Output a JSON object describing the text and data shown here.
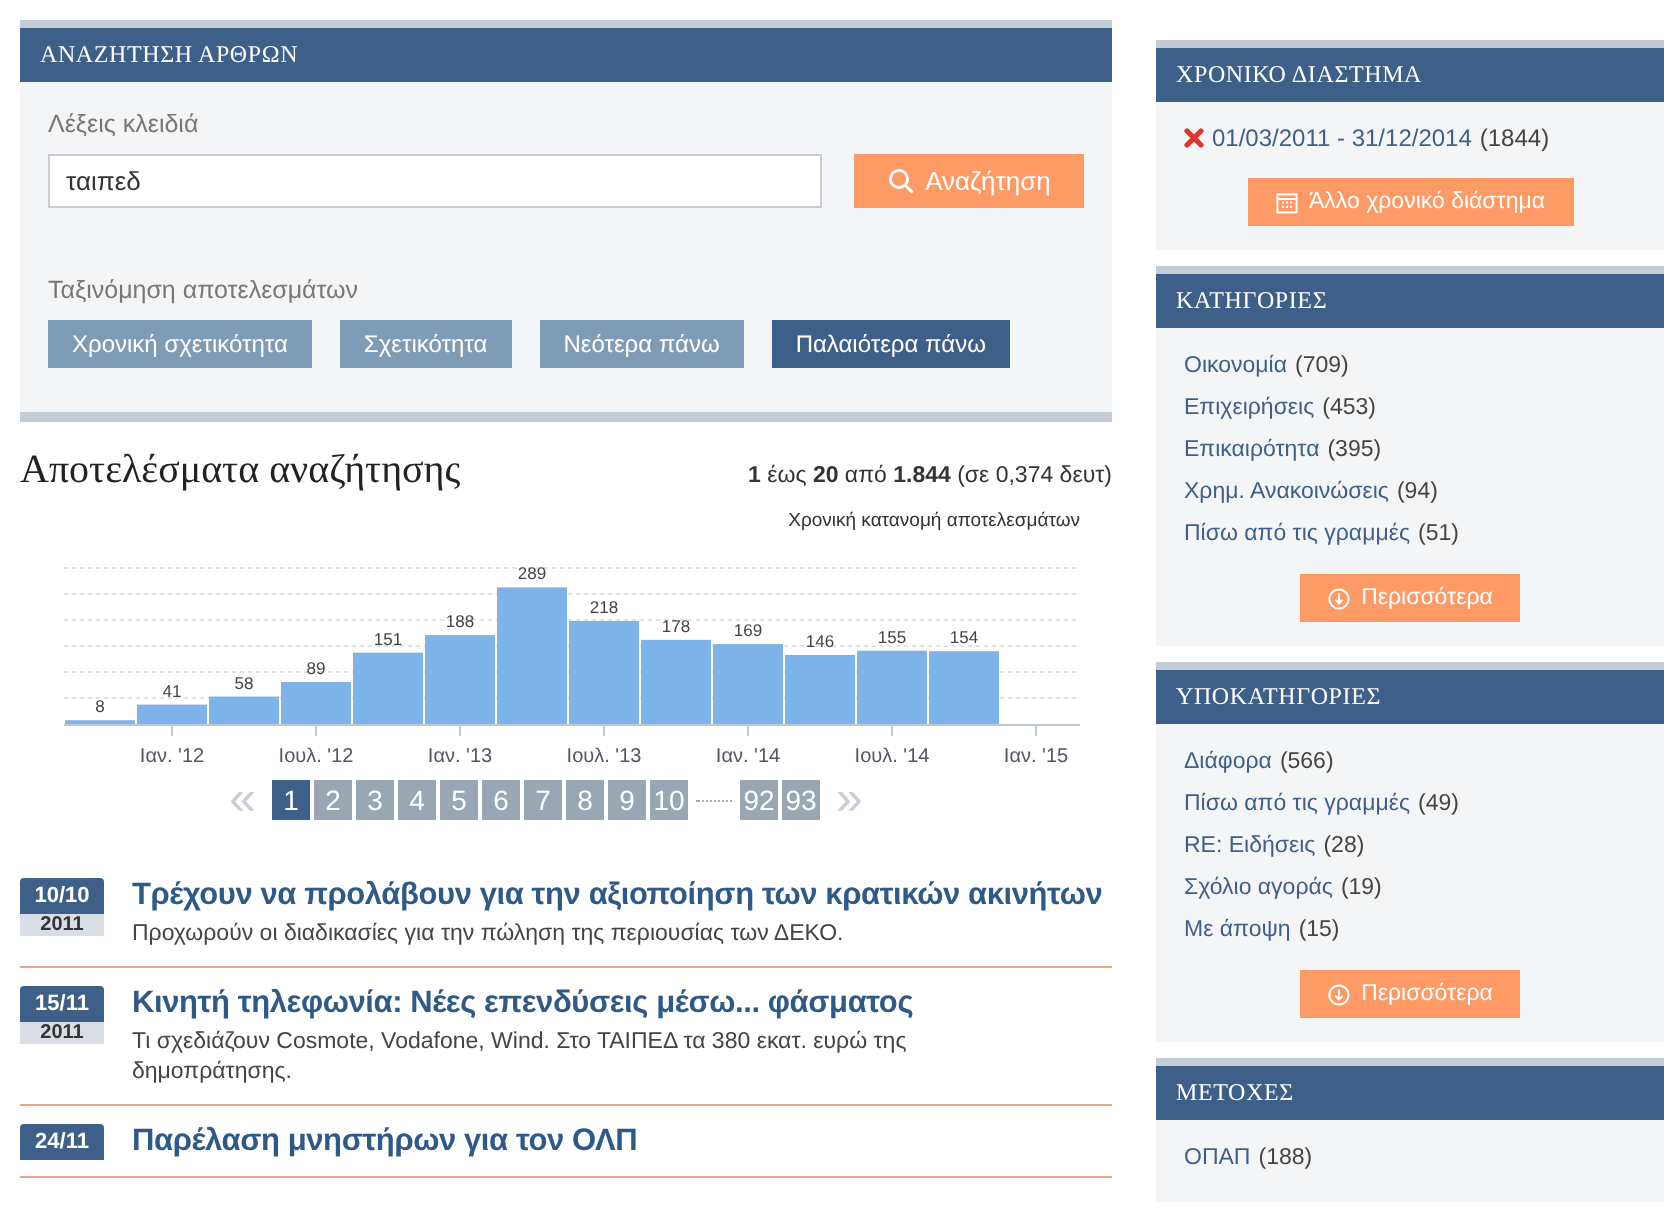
{
  "search_panel": {
    "title": "ΑΝΑΖΗΤΗΣΗ ΑΡΘΡΩΝ",
    "keywords_label": "Λέξεις κλειδιά",
    "keywords_value": "ταιπεδ",
    "search_button": "Αναζήτηση",
    "sort_label": "Ταξινόμηση αποτελεσμάτων",
    "sort_options": [
      {
        "label": "Χρονική σχετικότητα",
        "selected": false
      },
      {
        "label": "Σχετικότητα",
        "selected": false
      },
      {
        "label": "Νεότερα πάνω",
        "selected": false
      },
      {
        "label": "Παλαιότερα πάνω",
        "selected": true
      }
    ]
  },
  "results": {
    "title": "Αποτελέσματα αναζήτησης",
    "summary": "**1** έως **20** από **1.844** (σε 0,374 δευτ)",
    "chart": {
      "caption": "Χρονική κατανομή αποτελεσμάτων",
      "chart_data": {
        "type": "bar",
        "categories": [
          null,
          "Ιαν. '12",
          null,
          "Ιουλ. '12",
          null,
          "Ιαν. '13",
          null,
          "Ιουλ. '13",
          null,
          "Ιαν. '14",
          null,
          "Ιουλ. '14",
          null,
          "Ιαν. '15"
        ],
        "values": [
          8,
          41,
          58,
          89,
          151,
          188,
          289,
          218,
          178,
          169,
          146,
          155,
          154,
          null
        ],
        "ylim": [
          0,
          330
        ],
        "data_labels": true
      }
    },
    "pagination": [
      {
        "kind": "arrow",
        "label": "«",
        "selected": false
      },
      {
        "kind": "page",
        "label": "1",
        "selected": true
      },
      {
        "kind": "page",
        "label": "2",
        "selected": false
      },
      {
        "kind": "page",
        "label": "3",
        "selected": false
      },
      {
        "kind": "page",
        "label": "4",
        "selected": false
      },
      {
        "kind": "page",
        "label": "5",
        "selected": false
      },
      {
        "kind": "page",
        "label": "6",
        "selected": false
      },
      {
        "kind": "page",
        "label": "7",
        "selected": false
      },
      {
        "kind": "page",
        "label": "8",
        "selected": false
      },
      {
        "kind": "page",
        "label": "9",
        "selected": false
      },
      {
        "kind": "page",
        "label": "10",
        "selected": false
      },
      {
        "kind": "gap",
        "selected": false
      },
      {
        "kind": "page",
        "label": "92",
        "selected": false
      },
      {
        "kind": "page",
        "label": "93",
        "selected": false
      },
      {
        "kind": "arrow",
        "label": "»",
        "selected": false
      }
    ],
    "articles": [
      {
        "date": "10/10",
        "year": "2011",
        "title": "Τρέχουν να προλάβουν για την αξιοποίηση των κρατικών ακινήτων",
        "summary": "Προχωρούν οι διαδικασίες για την πώληση της περιουσίας των ΔΕΚΟ."
      },
      {
        "date": "15/11",
        "year": "2011",
        "title": "Κινητή τηλεφωνία: Νέες επενδύσεις μέσω... φάσματος",
        "summary": "Τι σχεδιάζουν Cosmote, Vodafone, Wind. Στο ΤΑΙΠΕΔ τα 380 εκατ. ευρώ της δημοπράτησης."
      },
      {
        "date": "24/11",
        "title": "Παρέλαση μνηστήρων για τον ΟΛΠ"
      }
    ]
  },
  "sidebar": [
    {
      "kind": "period",
      "title": "ΧΡΟΝΙΚΟ ΔΙΑΣΤΗΜΑ",
      "filter": "01/03/2011 - 31/12/2014",
      "count": "(1844)",
      "button": "Άλλο χρονικό διάστημα"
    },
    {
      "kind": "list",
      "title": "ΚΑΤΗΓΟΡΙΕΣ",
      "items": [
        {
          "label": "Οικονομία",
          "count": "(709)"
        },
        {
          "label": "Επιχειρήσεις",
          "count": "(453)"
        },
        {
          "label": "Επικαιρότητα",
          "count": "(395)"
        },
        {
          "label": "Χρημ. Ανακοινώσεις",
          "count": "(94)"
        },
        {
          "label": "Πίσω από τις γραμμές",
          "count": "(51)"
        }
      ],
      "button": "Περισσότερα"
    },
    {
      "kind": "list",
      "title": "ΥΠΟΚΑΤΗΓΟΡΙΕΣ",
      "items": [
        {
          "label": "Διάφορα",
          "count": "(566)"
        },
        {
          "label": "Πίσω από τις γραμμές",
          "count": "(49)"
        },
        {
          "label": "RE: Ειδήσεις",
          "count": "(28)"
        },
        {
          "label": "Σχόλιο αγοράς",
          "count": "(19)"
        },
        {
          "label": "Με άποψη",
          "count": "(15)"
        }
      ],
      "button": "Περισσότερα"
    },
    {
      "kind": "list",
      "title": "ΜΕΤΟΧΕΣ",
      "items": [
        {
          "label": "ΟΠΑΠ",
          "count": "(188)"
        }
      ]
    }
  ]
}
